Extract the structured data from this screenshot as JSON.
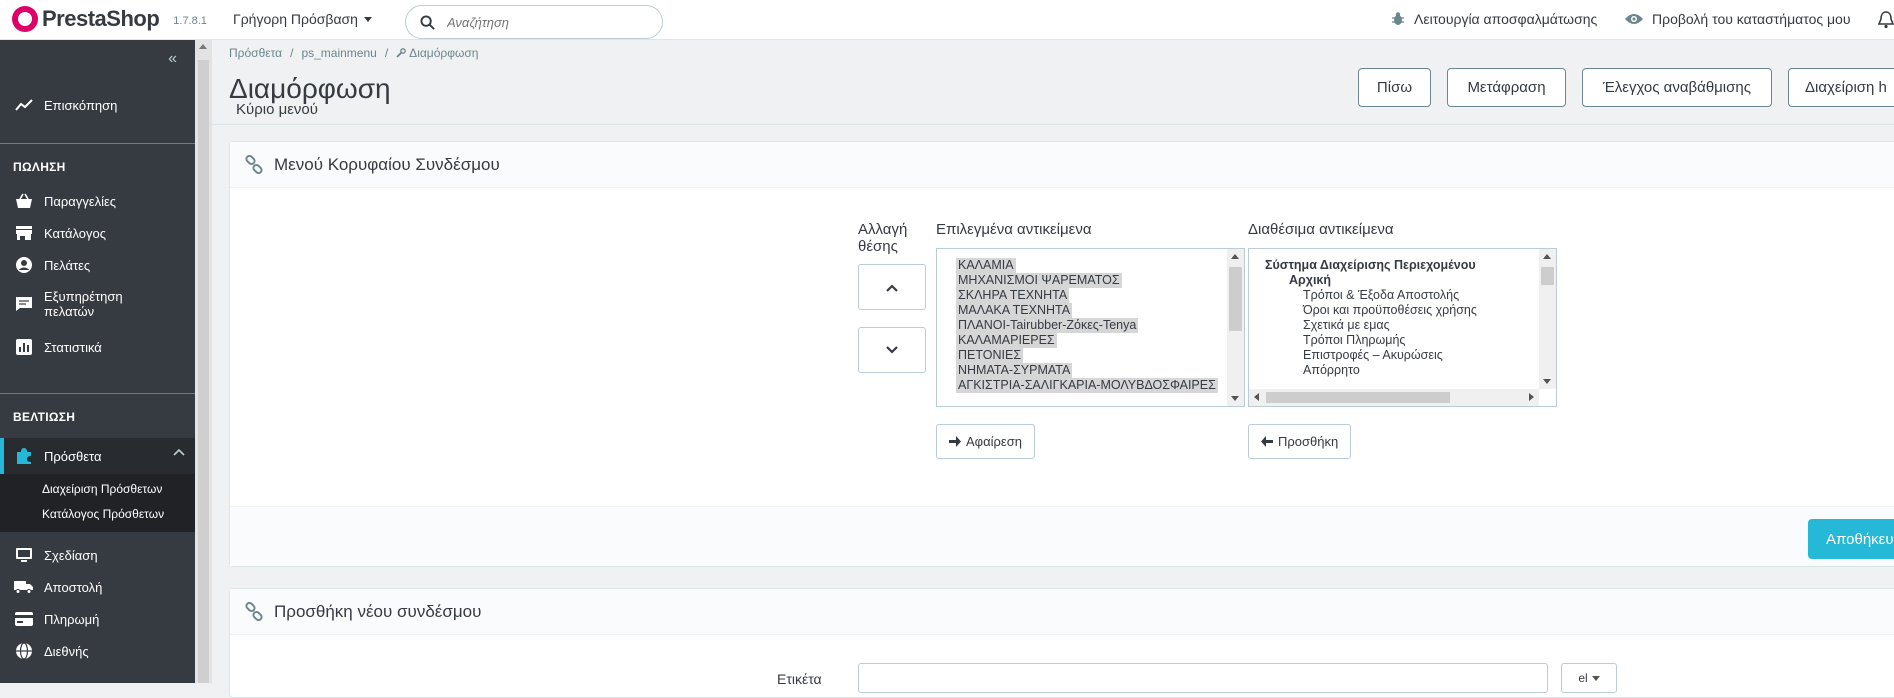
{
  "header": {
    "brand": "PrestaShop",
    "version": "1.7.8.1",
    "quick_access": "Γρήγορη Πρόσβαση",
    "search_placeholder": "Αναζήτηση",
    "debug_mode": "Λειτουργία αποσφαλμάτωσης",
    "view_shop": "Προβολή του καταστήματος μου"
  },
  "sidebar": {
    "dashboard": "Επισκόπηση",
    "section_sell": "ΠΩΛΗΣΗ",
    "orders": "Παραγγελίες",
    "catalog": "Κατάλογος",
    "customers": "Πελάτες",
    "customer_service_line1": "Εξυπηρέτηση",
    "customer_service_line2": "πελατών",
    "stats": "Στατιστικά",
    "section_improve": "ΒΕΛΤΙΩΣΗ",
    "modules": "Πρόσθετα",
    "module_manager": "Διαχείριση Πρόσθετων",
    "module_catalog": "Κατάλογος Πρόσθετων",
    "design": "Σχεδίαση",
    "shipping": "Αποστολή",
    "payment": "Πληρωμή",
    "international": "Διεθνής"
  },
  "breadcrumb": {
    "item1": "Πρόσθετα",
    "sep": "/",
    "item2": "ps_mainmenu",
    "item3": "Διαμόρφωση"
  },
  "page": {
    "title": "Διαμόρφωση",
    "subtitle": "Κύριο μενού",
    "buttons": {
      "back": "Πίσω",
      "translate": "Μετάφραση",
      "check_update": "Έλεγχος αναβάθμισης",
      "manage_hooks": "Διαχείριση h"
    }
  },
  "panel_menu": {
    "title": "Μενού Κορυφαίου Συνδέσμου",
    "change_position_line1": "Αλλαγή",
    "change_position_line2": "θέσης",
    "selected_label": "Επιλεγμένα αντικείμενα",
    "available_label": "Διαθέσιμα αντικείμενα",
    "selected_items": [
      "ΚΑΛΑΜΙΑ",
      "ΜΗΧΑΝΙΣΜΟΙ ΨΑΡΕΜΑΤΟΣ",
      "ΣΚΛΗΡΑ ΤΕΧΝΗΤΑ",
      "ΜΑΛΑΚΑ ΤΕΧΝΗΤΑ",
      "ΠΛΑΝΟΙ-Tairubber-Ζόκες-Tenya",
      "ΚΑΛΑΜΑΡΙΕΡΕΣ",
      "ΠΕΤΟΝΙΕΣ",
      "ΝΗΜΑΤΑ-ΣΥΡΜΑΤΑ",
      "ΑΓΚΙΣΤΡΙΑ-ΣΑΛΙΓΚΑΡΙΑ-ΜΟΛΥΒΔΟΣΦΑΙΡΕΣ"
    ],
    "available_items": [
      {
        "text": "Σύστημα Διαχείρισης Περιεχομένου",
        "level": 0,
        "bold": true
      },
      {
        "text": "Αρχική",
        "level": 1,
        "bold": true
      },
      {
        "text": "Τρόποι & Έξοδα Αποστολής",
        "level": 2,
        "bold": false
      },
      {
        "text": "Όροι και προϋποθέσεις χρήσης",
        "level": 2,
        "bold": false
      },
      {
        "text": "Σχετικά με εμας",
        "level": 2,
        "bold": false
      },
      {
        "text": "Τρόποι Πληρωμής",
        "level": 2,
        "bold": false
      },
      {
        "text": "Επιστροφές – Ακυρώσεις",
        "level": 2,
        "bold": false
      },
      {
        "text": "Απόρρητο",
        "level": 2,
        "bold": false
      }
    ],
    "remove_button": "Αφαίρεση",
    "add_button": "Προσθήκη",
    "save_button": "Αποθήκευση"
  },
  "panel_add": {
    "title": "Προσθήκη νέου συνδέσμου",
    "label_field": "Ετικέτα",
    "lang": "el"
  },
  "colors": {
    "accent": "#25b9d7",
    "sidebar": "#363a41",
    "brand": "#df0067"
  }
}
